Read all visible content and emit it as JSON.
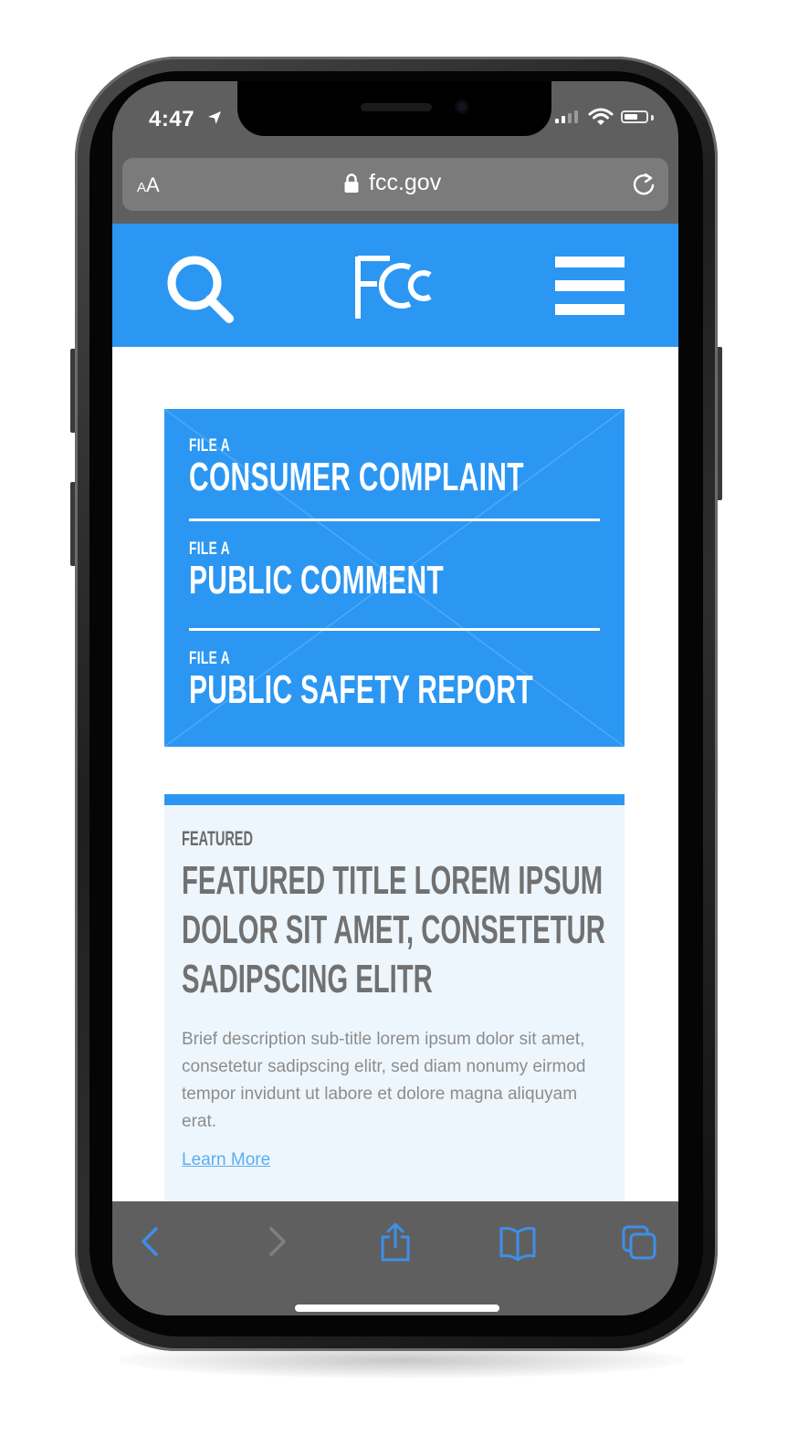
{
  "status_bar": {
    "time": "4:47"
  },
  "url_bar": {
    "text_size_small": "A",
    "text_size_large": "A",
    "domain": "fcc.gov"
  },
  "site_header": {
    "logo_text": "FCC"
  },
  "cta_panel": {
    "items": [
      {
        "prefix": "FILE A",
        "title": "CONSUMER COMPLAINT"
      },
      {
        "prefix": "FILE A",
        "title": "PUBLIC COMMENT"
      },
      {
        "prefix": "FILE A",
        "title": "PUBLIC SAFETY REPORT"
      }
    ]
  },
  "featured": {
    "kicker": "FEATURED",
    "title": "FEATURED TITLE LOREM IPSUM DOLOR SIT AMET, CONSETETUR SADIPSCING ELITR",
    "description": "Brief description sub-title lorem ipsum dolor sit amet, consetetur sadipscing elitr, sed diam nonumy eirmod tempor invidunt ut labore et dolore magna aliquyam erat.",
    "link": "Learn More"
  },
  "toolbar": {
    "icons": [
      "back-icon",
      "forward-icon",
      "share-icon",
      "bookmarks-icon",
      "tabs-icon"
    ]
  },
  "colors": {
    "brand_blue": "#2b97f3",
    "card_bg": "#eef6fd",
    "browser_gray": "#5f5f5f",
    "toolbar_blue": "#3e8fe8"
  }
}
